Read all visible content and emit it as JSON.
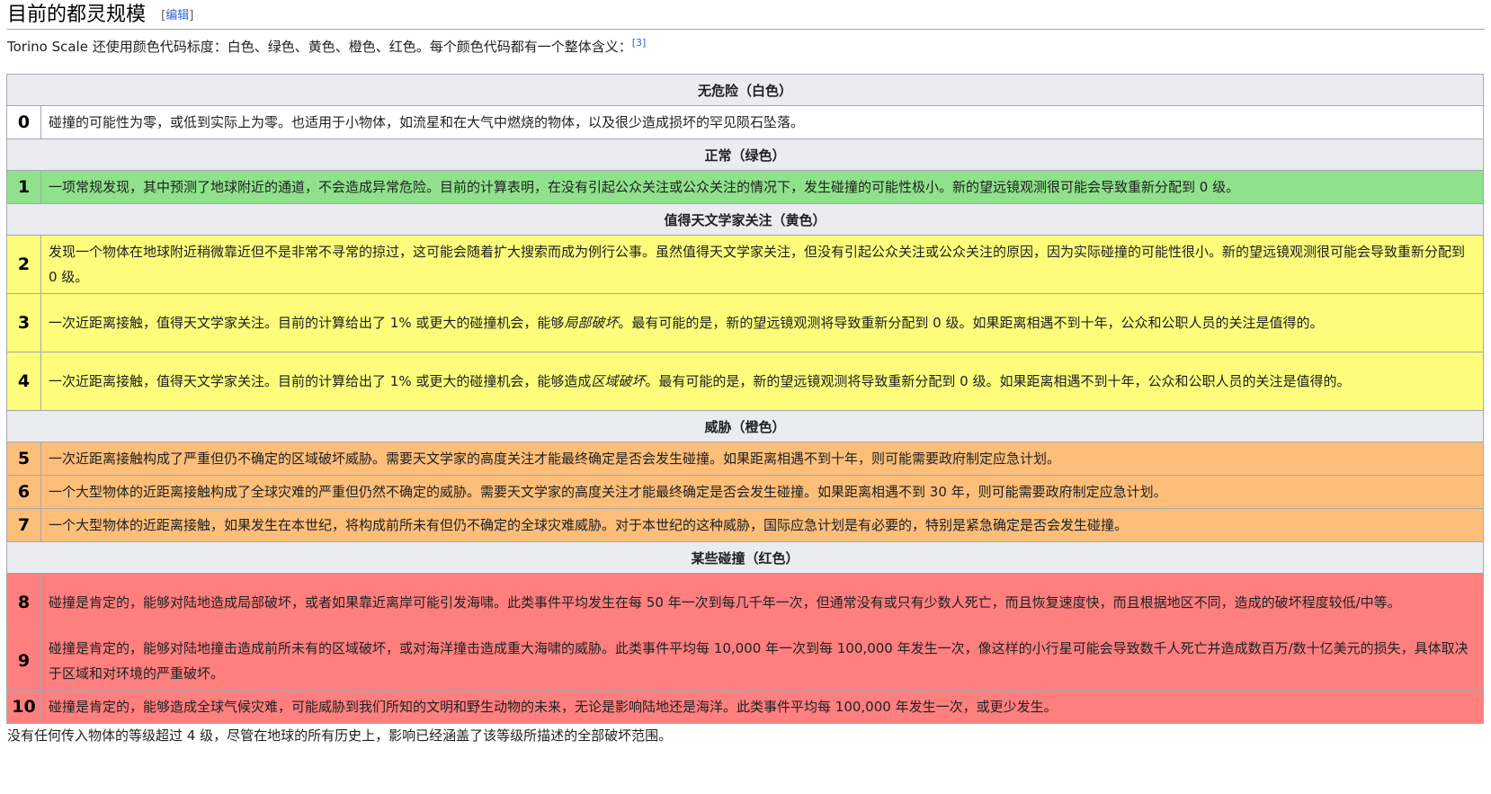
{
  "heading": {
    "title": "目前的都灵规模",
    "edit_open": "[",
    "edit_label": "编辑",
    "edit_close": "]"
  },
  "intro": {
    "text": "Torino Scale 还使用颜色代码标度：白色、绿色、黄色、橙色、红色。每个颜色代码都有一个整体含义：",
    "ref": "[3]"
  },
  "colors": {
    "white": "#ffffff",
    "green": "#8fe28b",
    "yellow": "#fdfd7b",
    "orange": "#fdbe79",
    "red": "#ff7f7f",
    "header": "#eaecf0",
    "link": "#3366cc"
  },
  "table": {
    "categories": {
      "white": "无危险（白色）",
      "green": "正常（绿色）",
      "yellow": "值得天文学家关注（黄色）",
      "orange": "威胁（橙色）",
      "red": "某些碰撞（红色）"
    },
    "levels": [
      {
        "num": "0",
        "text": "碰撞的可能性为零，或低到实际上为零。也适用于小物体，如流星和在大气中燃烧的物体，以及很少造成损坏的罕见陨石坠落。"
      },
      {
        "num": "1",
        "text": "一项常规发现，其中预测了地球附近的通道，不会造成异常危险。目前的计算表明，在没有引起公众关注或公众关注的情况下，发生碰撞的可能性极小。新的望远镜观测很可能会导致重新分配到 0 级。"
      },
      {
        "num": "2",
        "text": "发现一个物体在地球附近稍微靠近但不是非常不寻常的掠过，这可能会随着扩大搜索而成为例行公事。虽然值得天文学家关注，但没有引起公众关注或公众关注的原因，因为实际碰撞的可能性很小。新的望远镜观测很可能会导致重新分配到 0 级。"
      },
      {
        "num": "3",
        "text_before": "一次近距离接触，值得天文学家关注。目前的计算给出了 1% 或更大的碰撞机会，能够",
        "italic": "局部破坏",
        "text_after": "。最有可能的是，新的望远镜观测将导致重新分配到 0 级。如果距离相遇不到十年，公众和公职人员的关注是值得的。"
      },
      {
        "num": "4",
        "text_before": "一次近距离接触，值得天文学家关注。目前的计算给出了 1% 或更大的碰撞机会，能够造成",
        "italic": "区域破坏",
        "text_after": "。最有可能的是，新的望远镜观测将导致重新分配到 0 级。如果距离相遇不到十年，公众和公职人员的关注是值得的。"
      },
      {
        "num": "5",
        "text": "一次近距离接触构成了严重但仍不确定的区域破坏威胁。需要天文学家的高度关注才能最终确定是否会发生碰撞。如果距离相遇不到十年，则可能需要政府制定应急计划。"
      },
      {
        "num": "6",
        "text": "一个大型物体的近距离接触构成了全球灾难的严重但仍然不确定的威胁。需要天文学家的高度关注才能最终确定是否会发生碰撞。如果距离相遇不到 30 年，则可能需要政府制定应急计划。"
      },
      {
        "num": "7",
        "text": "一个大型物体的近距离接触，如果发生在本世纪，将构成前所未有但仍不确定的全球灾难威胁。对于本世纪的这种威胁，国际应急计划是有必要的，特别是紧急确定是否会发生碰撞。"
      },
      {
        "num": "8",
        "text": "碰撞是肯定的，能够对陆地造成局部破坏，或者如果靠近离岸可能引发海啸。此类事件平均发生在每 50 年一次到每几千年一次，但通常没有或只有少数人死亡，而且恢复速度快，而且根据地区不同，造成的破坏程度较低/中等。"
      },
      {
        "num": "9",
        "text": "碰撞是肯定的，能够对陆地撞击造成前所未有的区域破坏，或对海洋撞击造成重大海啸的威胁。此类事件平均每 10,000 年一次到每 100,000 年发生一次，像这样的小行星可能会导致数千人死亡并造成数百万/数十亿美元的损失，具体取决于区域和对环境的严重破坏。"
      },
      {
        "num": "10",
        "text": "碰撞是肯定的，能够造成全球气候灾难，可能威胁到我们所知的文明和野生动物的未来，无论是影响陆地还是海洋。此类事件平均每 100,000 年发生一次，或更少发生。"
      }
    ]
  },
  "footer": {
    "text": "没有任何传入物体的等级超过 4 级，尽管在地球的所有历史上，影响已经涵盖了该等级所描述的全部破坏范围。"
  }
}
